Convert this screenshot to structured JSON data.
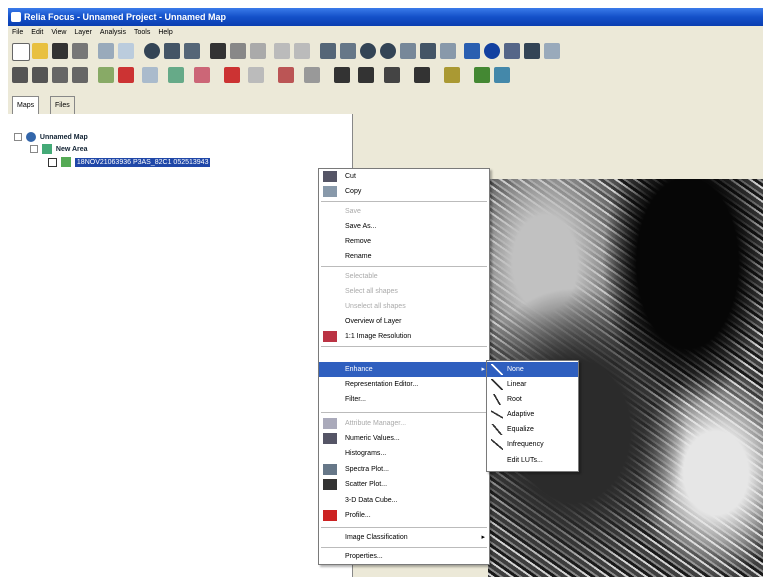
{
  "window": {
    "title": "Relia Focus - Unnamed Project - Unnamed Map"
  },
  "menubar": [
    "File",
    "Edit",
    "View",
    "Layer",
    "Analysis",
    "Tools",
    "Help"
  ],
  "tabs": [
    "Maps",
    "Files"
  ],
  "tree": {
    "root": "Unnamed Map",
    "area": "New Area",
    "layer": "18NOV21063936 P3AS_82C1 052513943"
  },
  "context_menu": {
    "items": [
      {
        "label": "Cut",
        "state": "enabled",
        "icon": "cut-icon"
      },
      {
        "label": "Copy",
        "state": "enabled",
        "icon": "copy-icon"
      },
      {
        "label": "Save",
        "state": "disabled"
      },
      {
        "label": "Save As...",
        "state": "enabled"
      },
      {
        "label": "Remove",
        "state": "enabled"
      },
      {
        "label": "Rename",
        "state": "enabled"
      },
      {
        "label": "Selectable",
        "state": "disabled"
      },
      {
        "label": "Select all shapes",
        "state": "disabled"
      },
      {
        "label": "Unselect all shapes",
        "state": "disabled"
      },
      {
        "label": "Overview of Layer",
        "state": "enabled"
      },
      {
        "label": "1:1 Image Resolution",
        "state": "enabled",
        "icon": "resolution-icon"
      },
      {
        "label": "Enhance",
        "state": "highlighted",
        "submenu": true
      },
      {
        "label": "Representation Editor...",
        "state": "enabled"
      },
      {
        "label": "Filter...",
        "state": "enabled"
      },
      {
        "label": "Attribute Manager...",
        "state": "disabled",
        "icon": "attribute-icon"
      },
      {
        "label": "Numeric Values...",
        "state": "enabled",
        "icon": "numeric-icon"
      },
      {
        "label": "Histograms...",
        "state": "enabled"
      },
      {
        "label": "Spectra Plot...",
        "state": "enabled",
        "icon": "spectra-icon"
      },
      {
        "label": "Scatter Plot...",
        "state": "enabled",
        "icon": "scatter-icon"
      },
      {
        "label": "3-D Data Cube...",
        "state": "enabled"
      },
      {
        "label": "Profile...",
        "state": "enabled",
        "icon": "profile-icon"
      },
      {
        "label": "Image Classification",
        "state": "enabled",
        "submenu": true
      },
      {
        "label": "Properties...",
        "state": "enabled"
      }
    ]
  },
  "enhance_submenu": {
    "items": [
      {
        "label": "None",
        "state": "highlighted",
        "icon": "none-curve-icon"
      },
      {
        "label": "Linear",
        "state": "enabled",
        "icon": "linear-curve-icon"
      },
      {
        "label": "Root",
        "state": "enabled",
        "icon": "root-curve-icon"
      },
      {
        "label": "Adaptive",
        "state": "enabled",
        "icon": "adaptive-curve-icon"
      },
      {
        "label": "Equalize",
        "state": "enabled",
        "icon": "equalize-curve-icon"
      },
      {
        "label": "Infrequency",
        "state": "enabled",
        "icon": "infrequency-curve-icon"
      },
      {
        "label": "Edit LUTs...",
        "state": "enabled"
      }
    ]
  }
}
